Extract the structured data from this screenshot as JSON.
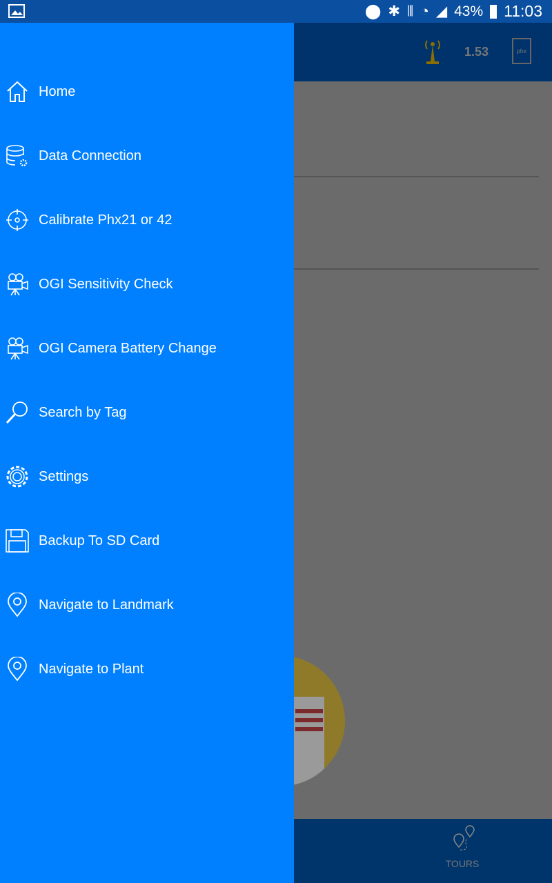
{
  "status_bar": {
    "battery": "43%",
    "time": "11:03"
  },
  "app_bar": {
    "value": "1.53",
    "phx_label": "phx"
  },
  "bottom_nav": {
    "tours_label": "TOURS"
  },
  "drawer": {
    "items": [
      {
        "label": "Home",
        "icon": "home-icon"
      },
      {
        "label": "Data Connection",
        "icon": "database-settings-icon"
      },
      {
        "label": "Calibrate Phx21 or 42",
        "icon": "crosshair-icon"
      },
      {
        "label": "OGI Sensitivity Check",
        "icon": "video-camera-icon"
      },
      {
        "label": "OGI Camera Battery Change",
        "icon": "video-camera-icon"
      },
      {
        "label": "Search by Tag",
        "icon": "magnifier-icon"
      },
      {
        "label": "Settings",
        "icon": "gear-icon"
      },
      {
        "label": "Backup To SD Card",
        "icon": "floppy-disk-icon"
      },
      {
        "label": "Navigate to Landmark",
        "icon": "map-pin-icon"
      },
      {
        "label": "Navigate to Plant",
        "icon": "map-pin-icon"
      }
    ]
  },
  "colors": {
    "drawer": "#0080ff",
    "status_bar": "#0a4fa0",
    "app_bar": "#00336b"
  }
}
